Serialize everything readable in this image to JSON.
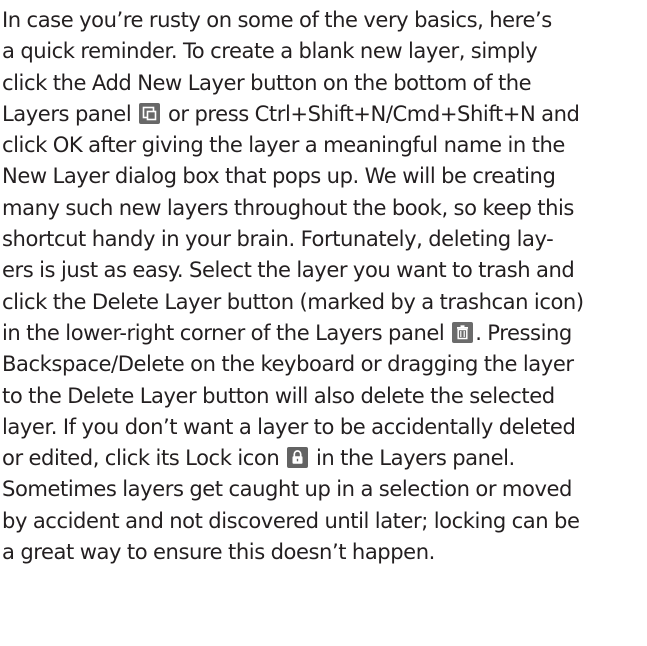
{
  "paragraph": {
    "lines": {
      "l1": "In case you’re rusty on some of the very basics, here’s",
      "l2": "a quick reminder. To create a blank new layer, simply",
      "l3": "click the Add New Layer button on the bottom of the",
      "l4a": "Layers panel",
      "l4b": "or press Ctrl+Shift+N/Cmd+Shift+N and",
      "l5": "click OK after giving the layer a meaningful name in the",
      "l6": "New Layer dialog box that pops up. We will be creating",
      "l7": "many such new layers throughout the book, so keep this",
      "l8": "shortcut handy in your brain. Fortunately, deleting lay-",
      "l9": "ers is just as easy. Select the layer you want to trash and",
      "l10": "click the Delete Layer button (marked by a trashcan icon)",
      "l11a": "in the lower-right corner of the Layers panel",
      "l11b": ". Pressing",
      "l12": "Backspace/Delete on the keyboard or dragging the layer",
      "l13": "to the Delete Layer button will also delete the selected",
      "l14": "layer. If you don’t want a layer to be accidentally deleted",
      "l15a": "or edited, click its Lock icon",
      "l15b": "in the Layers panel.",
      "l16": "Sometimes layers get caught up in a selection or moved",
      "l17": "by accident and not discovered until later; locking can be",
      "l18": "a great way to ensure this doesn’t happen."
    }
  },
  "icons": {
    "new_layer": "new-layer-icon",
    "trash": "trash-icon",
    "lock": "lock-icon"
  },
  "colors": {
    "text": "#231f20",
    "icon_bg": "#686868"
  }
}
